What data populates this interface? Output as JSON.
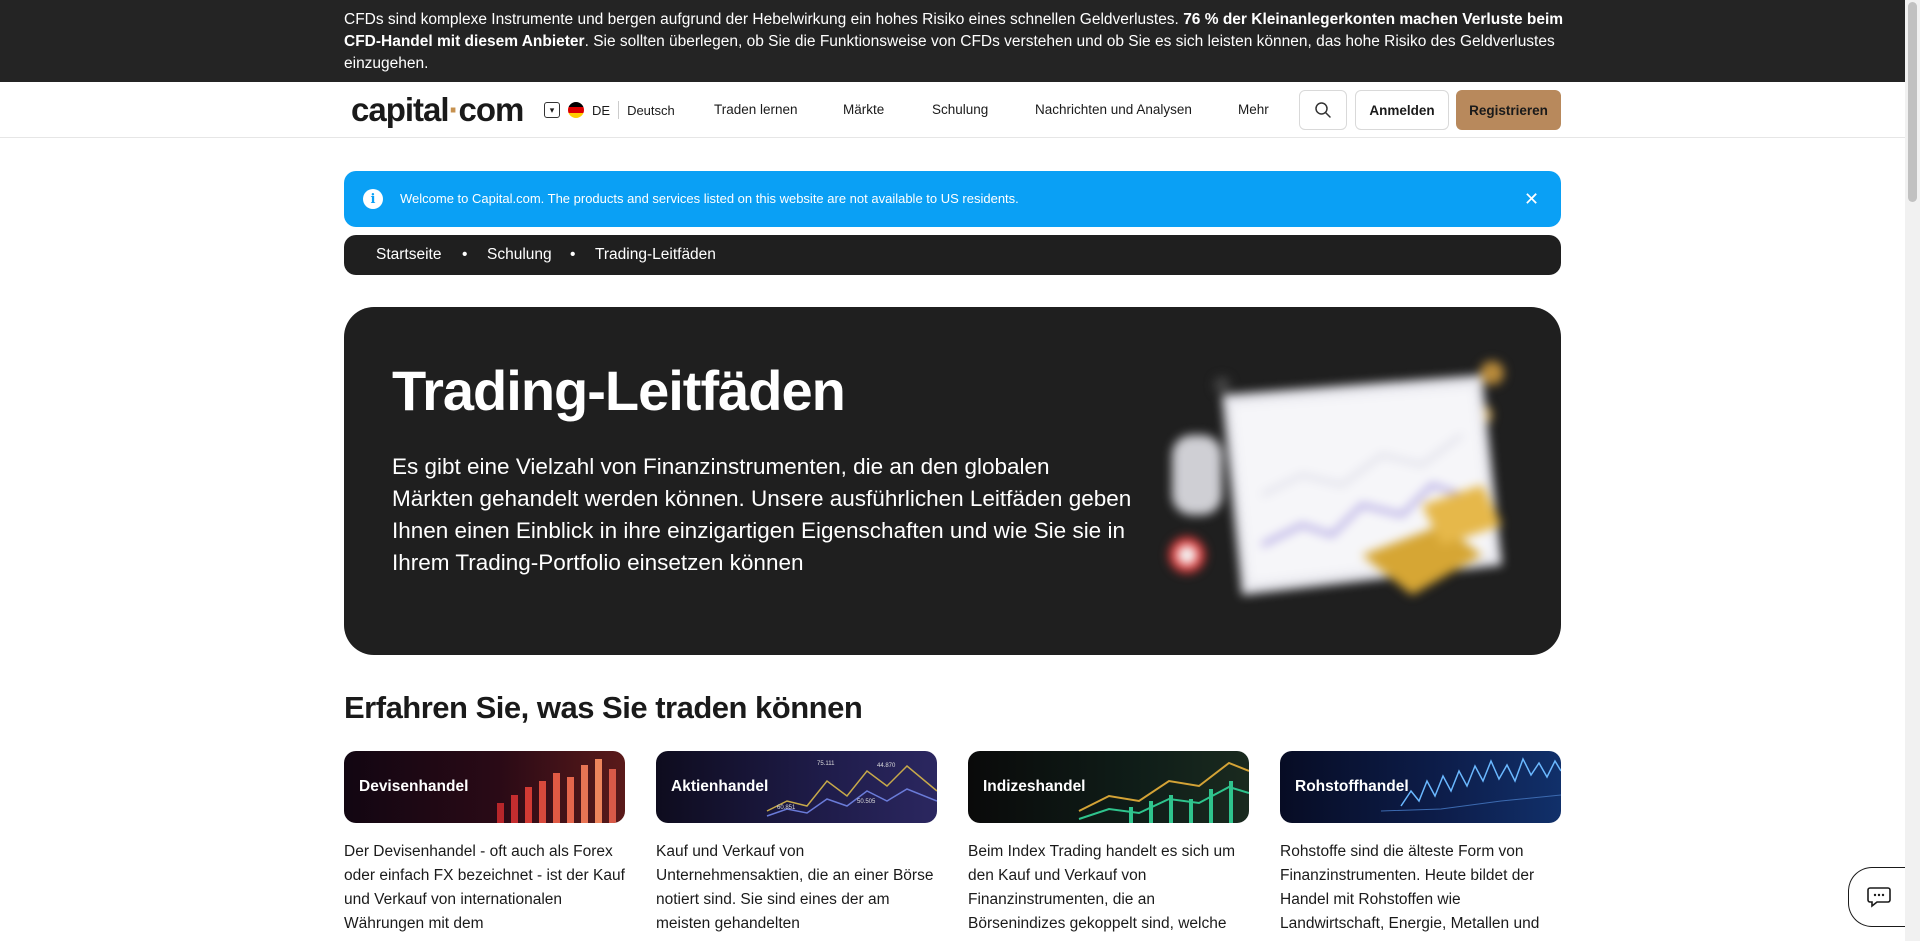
{
  "risk_banner": {
    "text_1": "CFDs sind komplexe Instrumente und bergen aufgrund der Hebelwirkung ein hohes Risiko eines schnellen Geldverlustes. ",
    "text_bold": "76 % der Kleinanlegerkonten machen Verluste beim CFD-Handel mit diesem Anbieter",
    "text_2": ". Sie sollten überlegen, ob Sie die Funktionsweise von CFDs verstehen und ob Sie es sich leisten können, das hohe Risiko des Geldverlustes einzugehen."
  },
  "header": {
    "logo_part1": "capital",
    "logo_dot": "·",
    "logo_part2": "com",
    "lang_code": "DE",
    "lang_name": "Deutsch",
    "nav": [
      "Traden lernen",
      "Märkte",
      "Schulung",
      "Nachrichten und Analysen",
      "Mehr"
    ],
    "login_label": "Anmelden",
    "register_label": "Registrieren"
  },
  "info_bar": {
    "text": "Welcome to Capital.com. The products and services listed on this website are not available to US residents.",
    "close": "✕"
  },
  "breadcrumb": [
    "Startseite",
    "Schulung",
    "Trading-Leitfäden"
  ],
  "hero": {
    "title": "Trading-Leitfäden",
    "description": "Es gibt eine Vielzahl von Finanzinstrumenten, die an den globalen Märkten gehandelt werden können. Unsere ausführlichen Leitfäden geben Ihnen einen Einblick in ihre einzigartigen Eigenschaften und wie Sie sie in Ihrem Trading-Portfolio einsetzen können"
  },
  "section": {
    "title": "Erfahren Sie, was Sie traden können",
    "cards": [
      {
        "title": "Devisenhandel",
        "desc": "Der Devisenhandel - oft auch als Forex oder einfach FX bezeichnet - ist der Kauf und Verkauf von internationalen Währungen mit dem"
      },
      {
        "title": "Aktienhandel",
        "desc": "Kauf und Verkauf von Unternehmensaktien, die an einer Börse notiert sind. Sie sind eines der am meisten gehandelten"
      },
      {
        "title": "Indizeshandel",
        "desc": "Beim Index Trading handelt es sich um den Kauf und Verkauf von Finanzinstrumenten, die an Börsenindizes gekoppelt sind, welche"
      },
      {
        "title": "Rohstoffhandel",
        "desc": "Rohstoffe sind die älteste Form von Finanzinstrumenten. Heute bildet der Handel mit Rohstoffen wie Landwirtschaft, Energie, Metallen und"
      }
    ],
    "stock_chart_labels": [
      "75.111",
      "44.870",
      "50.505",
      "60.851"
    ]
  },
  "colors": {
    "accent": "#b8895c",
    "info": "#0aa0f5",
    "dark": "#1f1f1f"
  }
}
